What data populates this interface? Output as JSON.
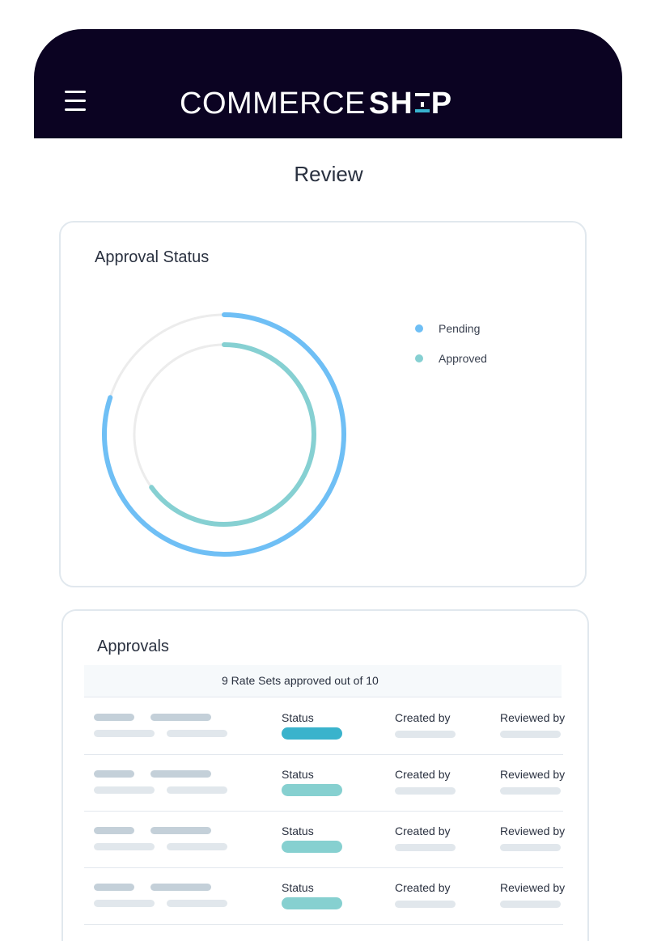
{
  "header": {
    "logo_light": "COMMERCE",
    "logo_bold_1": "SH",
    "logo_bold_2": "P",
    "menu_icon": "hamburger-menu-icon",
    "background": "#0b0322",
    "accent": "#38b3cf"
  },
  "page": {
    "title": "Review"
  },
  "approval_status": {
    "title": "Approval Status",
    "legend": [
      {
        "label": "Pending",
        "color": "#6fbff5"
      },
      {
        "label": "Approved",
        "color": "#86d0d2"
      }
    ],
    "track_color": "#ececec",
    "rings": [
      {
        "name": "Pending",
        "fraction": 0.8
      },
      {
        "name": "Approved",
        "fraction": 0.65
      }
    ]
  },
  "approvals": {
    "title": "Approvals",
    "summary": "9 Rate Sets approved out of 10",
    "columns": {
      "status": "Status",
      "created_by": "Created by",
      "reviewed_by": "Reviewed by"
    },
    "rows": [
      {
        "status_color": "#3ab3cc"
      },
      {
        "status_color": "#86d0d0"
      },
      {
        "status_color": "#86d0d0"
      },
      {
        "status_color": "#86d0d0"
      }
    ]
  }
}
